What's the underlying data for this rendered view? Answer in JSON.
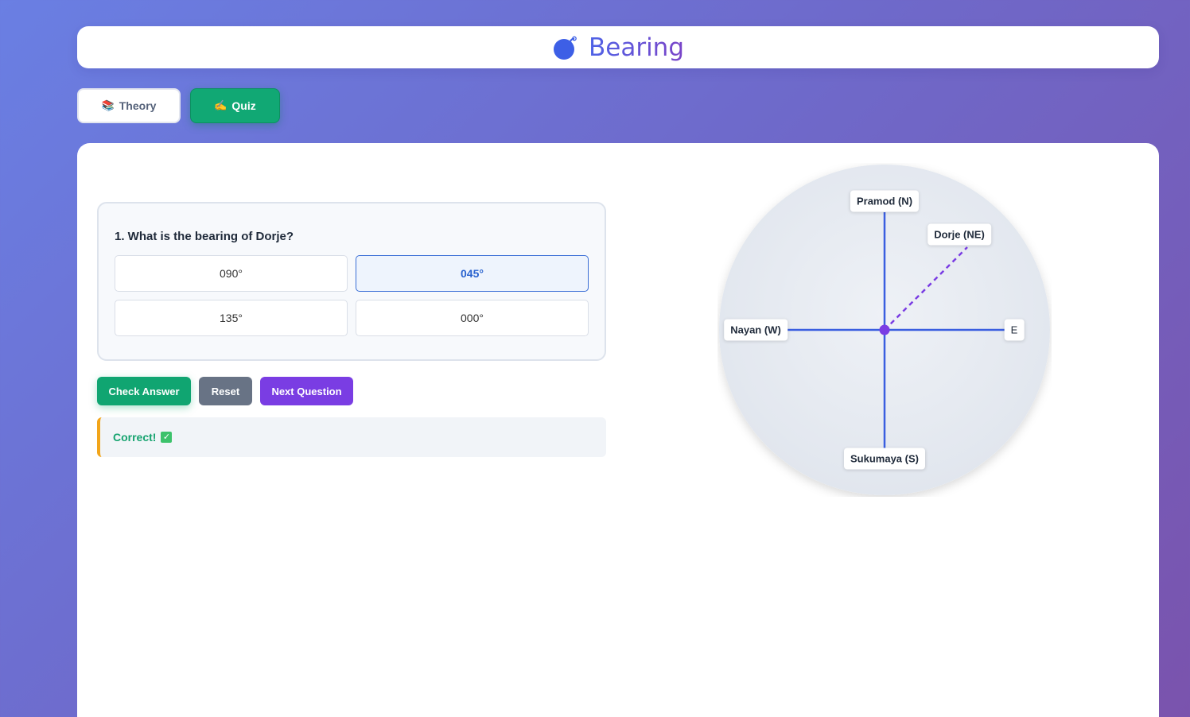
{
  "header": {
    "title": "Bearing",
    "logo_icon": "bomb-icon"
  },
  "tabs": [
    {
      "label": "Theory",
      "icon": "📚"
    },
    {
      "label": "Quiz",
      "icon": "✍️"
    }
  ],
  "quiz": {
    "question": "1. What is the bearing of Dorje?",
    "options": [
      "090°",
      "045°",
      "135°",
      "000°"
    ],
    "selected_option": "045°"
  },
  "buttons": {
    "check": "Check Answer",
    "reset": "Reset",
    "next": "Next Question"
  },
  "feedback": {
    "text": "Correct!",
    "icon": "✓"
  },
  "compass": {
    "labels": {
      "north": "Pramod (N)",
      "northeast": "Dorje (NE)",
      "west": "Nayan (W)",
      "east": "E",
      "south": "Sukumaya (S)"
    },
    "colors": {
      "axes": "#3a5ee0",
      "bearing_line": "#7a3de3",
      "center": "#7a3de3"
    }
  },
  "colors": {
    "accent_green": "#10a571",
    "accent_purple": "#7a3de3",
    "reset_gray": "#687385",
    "selected_blue": "#2a63cf"
  }
}
